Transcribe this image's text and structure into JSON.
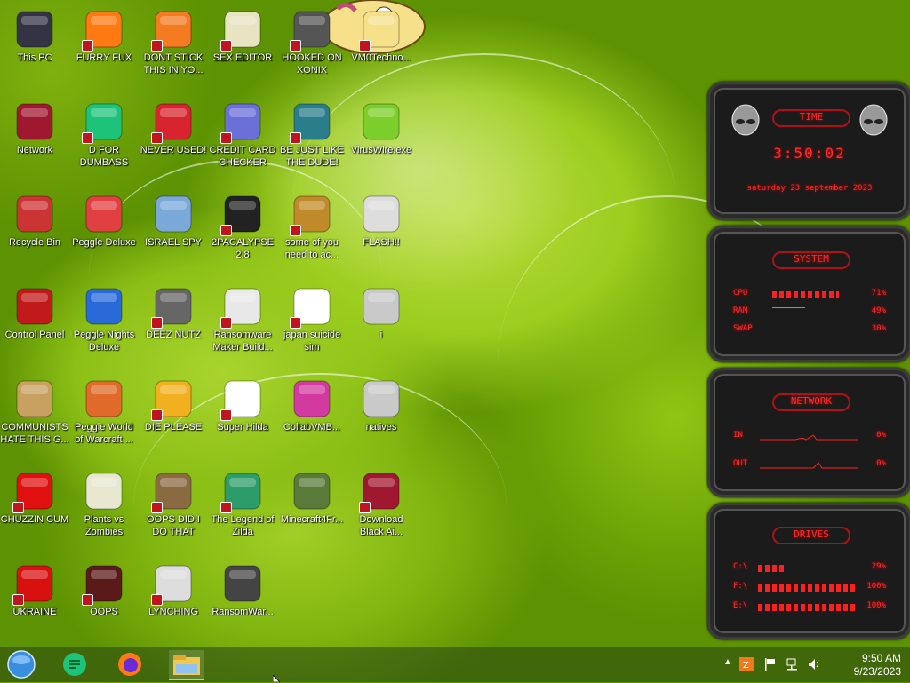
{
  "desktop": {
    "icons": [
      {
        "label": "This PC",
        "icon": "computer-icon"
      },
      {
        "label": "FURRY FUX",
        "icon": "firefox-icon"
      },
      {
        "label": "DONT STICK THIS IN YO...",
        "icon": "vlc-cone-icon"
      },
      {
        "label": "SEX EDITOR",
        "icon": "hex-editor-icon"
      },
      {
        "label": "HOOKED ON XONIX",
        "icon": "game-icon"
      },
      {
        "label": "VM0Techno...",
        "icon": "cartoon-icon"
      },
      {
        "label": "Network",
        "icon": "network-icon"
      },
      {
        "label": "D FOR DUMBASS",
        "icon": "chat-icon"
      },
      {
        "label": "NEVER USED!",
        "icon": "devcpp-icon"
      },
      {
        "label": "CREDIT CARD CHECKER",
        "icon": "credit-card-icon"
      },
      {
        "label": "BE JUST LIKE THE DUDE!",
        "icon": "santa-icon"
      },
      {
        "label": "VirusWire.exe",
        "icon": "lime-icon"
      },
      {
        "label": "Recycle Bin",
        "icon": "recycle-bin-icon"
      },
      {
        "label": "Peggle Deluxe",
        "icon": "peggle-icon"
      },
      {
        "label": "ISRAEL SPY",
        "icon": "network-pc-icon"
      },
      {
        "label": "2PACALYPSE 2.8",
        "icon": "terminal-icon"
      },
      {
        "label": "some of you need to ac...",
        "icon": "dog-icon"
      },
      {
        "label": "FLASH!!",
        "icon": "flash-icon"
      },
      {
        "label": "Control Panel",
        "icon": "control-panel-icon"
      },
      {
        "label": "Peggle Nights Deluxe",
        "icon": "peggle-nights-icon"
      },
      {
        "label": "DEEZ NUTZ",
        "icon": "windows-stack-icon"
      },
      {
        "label": "Ransomware Maker Build...",
        "icon": "window-icon"
      },
      {
        "label": "japan suicide sim",
        "icon": "japan-sim-icon"
      },
      {
        "label": "i",
        "icon": "file-icon"
      },
      {
        "label": "COMMUNISTS HATE THIS G...",
        "icon": "money-bag-icon"
      },
      {
        "label": "Peggle World of Warcraft ...",
        "icon": "peggle-wow-icon"
      },
      {
        "label": "DIE PLEASE",
        "icon": "de-icon"
      },
      {
        "label": "Super Hilda",
        "icon": "pixel-cat-icon"
      },
      {
        "label": "CollabVMB...",
        "icon": "monitor-icon"
      },
      {
        "label": "natives",
        "icon": "file-icon"
      },
      {
        "label": "CHUZZIN CUM",
        "icon": "chuzzle-icon"
      },
      {
        "label": "Plants vs Zombies",
        "icon": "plant-icon"
      },
      {
        "label": "OOPS DID I DO THAT",
        "icon": "portrait-icon"
      },
      {
        "label": "The Legend of Zilda",
        "icon": "zelda-icon"
      },
      {
        "label": "Minecraft4Fr...",
        "icon": "minecraft-icon"
      },
      {
        "label": "Download Black Ai...",
        "icon": "download-icon"
      },
      {
        "label": "UKRAINE",
        "icon": "radiation-icon"
      },
      {
        "label": "OOPS",
        "icon": "oops-icon"
      },
      {
        "label": "LYNCHING",
        "icon": "rope-icon"
      },
      {
        "label": "RansomWar...",
        "icon": "skull-icon"
      }
    ]
  },
  "gadget": {
    "time": {
      "title": "TIME",
      "clock": "3:50:02",
      "date": "saturday 23 september 2023"
    },
    "system": {
      "title": "SYSTEM",
      "rows": [
        {
          "key": "CPU",
          "value": "71%",
          "level": 0.71
        },
        {
          "key": "RAM",
          "value": "49%",
          "level": 0.49
        },
        {
          "key": "SWAP",
          "value": "30%",
          "level": 0.3
        }
      ]
    },
    "network": {
      "title": "NETWORK",
      "rows": [
        {
          "key": "IN",
          "value": "0%"
        },
        {
          "key": "OUT",
          "value": "0%"
        }
      ]
    },
    "drives": {
      "title": "DRIVES",
      "rows": [
        {
          "key": "C:\\",
          "value": "29%",
          "level": 0.29
        },
        {
          "key": "F:\\",
          "value": "100%",
          "level": 1.0
        },
        {
          "key": "E:\\",
          "value": "100%",
          "level": 1.0
        }
      ]
    }
  },
  "taskbar": {
    "items": [
      {
        "name": "start-orb"
      },
      {
        "name": "chat-app"
      },
      {
        "name": "firefox"
      },
      {
        "name": "file-explorer"
      }
    ],
    "tray": {
      "time": "9:50 AM",
      "date": "9/23/2023"
    }
  },
  "colors": {
    "gadget_red": "#ff2a2a",
    "taskbar": "#2d4a16"
  }
}
